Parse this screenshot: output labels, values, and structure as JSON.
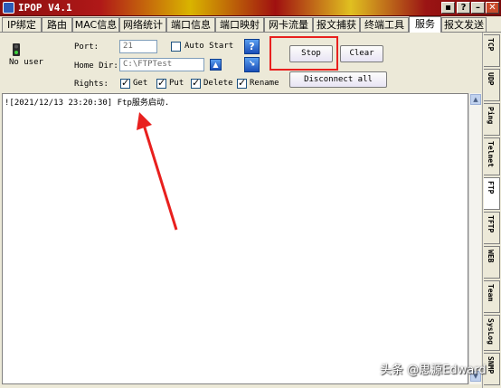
{
  "window": {
    "title": "IPOP V4.1",
    "help_label": "?",
    "min_label": "–",
    "close_label": "✕"
  },
  "tabs": [
    {
      "label": "IP绑定"
    },
    {
      "label": "路由"
    },
    {
      "label": "MAC信息"
    },
    {
      "label": "网络统计"
    },
    {
      "label": "端口信息"
    },
    {
      "label": "端口映射"
    },
    {
      "label": "网卡流量"
    },
    {
      "label": "报文捕获"
    },
    {
      "label": "终端工具"
    },
    {
      "label": "服务"
    },
    {
      "label": "报文发送"
    }
  ],
  "ftp": {
    "status_label": "No user",
    "port_label": "Port:",
    "port_value": "21",
    "auto_start_label": "Auto Start",
    "home_dir_label": "Home Dir:",
    "home_dir_value": "C:\\FTPTest",
    "rights_label": "Rights:",
    "rights": [
      {
        "label": "Get",
        "checked": true
      },
      {
        "label": "Put",
        "checked": true
      },
      {
        "label": "Delete",
        "checked": true
      },
      {
        "label": "Rename",
        "checked": true
      }
    ],
    "help_button_label": "?",
    "stop_label": "Stop",
    "clear_label": "Clear",
    "disconnect_label": "Disconnect all"
  },
  "log": {
    "lines": [
      "![2021/12/13 23:20:30] Ftp服务启动."
    ]
  },
  "side_tabs": [
    {
      "label": "TCP"
    },
    {
      "label": "UDP"
    },
    {
      "label": "Ping"
    },
    {
      "label": "Telnet"
    },
    {
      "label": "FTP"
    },
    {
      "label": "TFTP"
    },
    {
      "label": "WEB"
    },
    {
      "label": "Team"
    },
    {
      "label": "SysLog"
    },
    {
      "label": "SNMP"
    }
  ],
  "watermark": "头条 @思源Edward",
  "colors": {
    "highlight": "#e8201e",
    "arrow": "#e8201e",
    "active_tab": "#ffffff"
  }
}
